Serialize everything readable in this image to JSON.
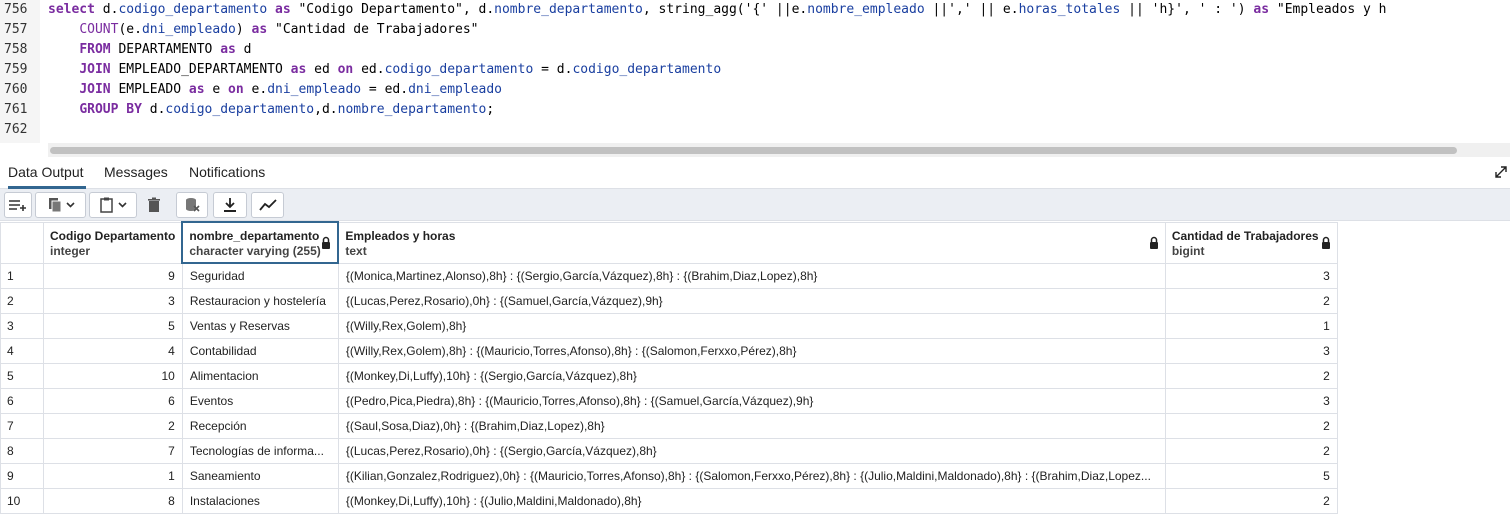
{
  "editor": {
    "lines": [
      {
        "n": "756",
        "segments": [
          {
            "t": "select ",
            "c": "kw"
          },
          {
            "t": "d.",
            "c": "plain"
          },
          {
            "t": "codigo_departamento",
            "c": "id"
          },
          {
            "t": " ",
            "c": "plain"
          },
          {
            "t": "as",
            "c": "kw"
          },
          {
            "t": " \"Codigo Departamento\", d.",
            "c": "plain"
          },
          {
            "t": "nombre_departamento",
            "c": "id"
          },
          {
            "t": ", string_agg('{' ||e.",
            "c": "plain"
          },
          {
            "t": "nombre_empleado",
            "c": "id"
          },
          {
            "t": " ||',' || e.",
            "c": "plain"
          },
          {
            "t": "horas_totales",
            "c": "id"
          },
          {
            "t": " || 'h}', ' : ') ",
            "c": "plain"
          },
          {
            "t": "as",
            "c": "kw"
          },
          {
            "t": " \"Empleados y h",
            "c": "plain"
          }
        ]
      },
      {
        "n": "757",
        "segments": [
          {
            "t": "    ",
            "c": "plain"
          },
          {
            "t": "COUNT",
            "c": "fn"
          },
          {
            "t": "(e.",
            "c": "plain"
          },
          {
            "t": "dni_empleado",
            "c": "id"
          },
          {
            "t": ") ",
            "c": "plain"
          },
          {
            "t": "as",
            "c": "kw"
          },
          {
            "t": " \"Cantidad de Trabajadores\"",
            "c": "plain"
          }
        ]
      },
      {
        "n": "758",
        "segments": [
          {
            "t": "    ",
            "c": "plain"
          },
          {
            "t": "FROM",
            "c": "kw"
          },
          {
            "t": " DEPARTAMENTO ",
            "c": "plain"
          },
          {
            "t": "as",
            "c": "kw"
          },
          {
            "t": " d",
            "c": "plain"
          }
        ]
      },
      {
        "n": "759",
        "segments": [
          {
            "t": "    ",
            "c": "plain"
          },
          {
            "t": "JOIN",
            "c": "kw"
          },
          {
            "t": " EMPLEADO_DEPARTAMENTO ",
            "c": "plain"
          },
          {
            "t": "as",
            "c": "kw"
          },
          {
            "t": " ed ",
            "c": "plain"
          },
          {
            "t": "on",
            "c": "kw"
          },
          {
            "t": " ed.",
            "c": "plain"
          },
          {
            "t": "codigo_departamento",
            "c": "id"
          },
          {
            "t": " = d.",
            "c": "plain"
          },
          {
            "t": "codigo_departamento",
            "c": "id"
          }
        ]
      },
      {
        "n": "760",
        "segments": [
          {
            "t": "    ",
            "c": "plain"
          },
          {
            "t": "JOIN",
            "c": "kw"
          },
          {
            "t": " EMPLEADO ",
            "c": "plain"
          },
          {
            "t": "as",
            "c": "kw"
          },
          {
            "t": " e ",
            "c": "plain"
          },
          {
            "t": "on",
            "c": "kw"
          },
          {
            "t": " e.",
            "c": "plain"
          },
          {
            "t": "dni_empleado",
            "c": "id"
          },
          {
            "t": " = ed.",
            "c": "plain"
          },
          {
            "t": "dni_empleado",
            "c": "id"
          }
        ]
      },
      {
        "n": "761",
        "segments": [
          {
            "t": "    ",
            "c": "plain"
          },
          {
            "t": "GROUP BY",
            "c": "kw"
          },
          {
            "t": " d.",
            "c": "plain"
          },
          {
            "t": "codigo_departamento",
            "c": "id"
          },
          {
            "t": ",d.",
            "c": "plain"
          },
          {
            "t": "nombre_departamento",
            "c": "id"
          },
          {
            "t": ";",
            "c": "plain"
          }
        ]
      },
      {
        "n": "762",
        "segments": []
      }
    ]
  },
  "tabs": {
    "data_output": "Data Output",
    "messages": "Messages",
    "notifications": "Notifications"
  },
  "toolbar": {
    "icons": [
      "add-row-icon",
      "copy-icon",
      "copy-dropdown-icon",
      "paste-icon",
      "paste-dropdown-icon",
      "delete-icon",
      "save-data-icon",
      "download-icon",
      "graph-icon"
    ]
  },
  "columns": [
    {
      "name": "Codigo Departamento",
      "type": "integer",
      "locked": false
    },
    {
      "name": "nombre_departamento",
      "type": "character varying (255)",
      "locked": true
    },
    {
      "name": "Empleados y horas",
      "type": "text",
      "locked": true
    },
    {
      "name": "Cantidad de Trabajadores",
      "type": "bigint",
      "locked": true
    }
  ],
  "rows": [
    {
      "n": "1",
      "codigo": "9",
      "nombre": "Seguridad",
      "empleados": "{(Monica,Martinez,Alonso),8h} : {(Sergio,García,Vázquez),8h} : {(Brahim,Diaz,Lopez),8h}",
      "cantidad": "3"
    },
    {
      "n": "2",
      "codigo": "3",
      "nombre": "Restauracion y hostelería",
      "empleados": "{(Lucas,Perez,Rosario),0h} : {(Samuel,García,Vázquez),9h}",
      "cantidad": "2"
    },
    {
      "n": "3",
      "codigo": "5",
      "nombre": "Ventas y Reservas",
      "empleados": "{(Willy,Rex,Golem),8h}",
      "cantidad": "1"
    },
    {
      "n": "4",
      "codigo": "4",
      "nombre": "Contabilidad",
      "empleados": "{(Willy,Rex,Golem),8h} : {(Mauricio,Torres,Afonso),8h} : {(Salomon,Ferxxo,Pérez),8h}",
      "cantidad": "3"
    },
    {
      "n": "5",
      "codigo": "10",
      "nombre": "Alimentacion",
      "empleados": "{(Monkey,Di,Luffy),10h} : {(Sergio,García,Vázquez),8h}",
      "cantidad": "2"
    },
    {
      "n": "6",
      "codigo": "6",
      "nombre": "Eventos",
      "empleados": "{(Pedro,Pica,Piedra),8h} : {(Mauricio,Torres,Afonso),8h} : {(Samuel,García,Vázquez),9h}",
      "cantidad": "3"
    },
    {
      "n": "7",
      "codigo": "2",
      "nombre": "Recepción",
      "empleados": "{(Saul,Sosa,Diaz),0h} : {(Brahim,Diaz,Lopez),8h}",
      "cantidad": "2"
    },
    {
      "n": "8",
      "codigo": "7",
      "nombre": "Tecnologías de informa...",
      "empleados": "{(Lucas,Perez,Rosario),0h} : {(Sergio,García,Vázquez),8h}",
      "cantidad": "2"
    },
    {
      "n": "9",
      "codigo": "1",
      "nombre": "Saneamiento",
      "empleados": "{(Kilian,Gonzalez,Rodriguez),0h} : {(Mauricio,Torres,Afonso),8h} : {(Salomon,Ferxxo,Pérez),8h} : {(Julio,Maldini,Maldonado),8h} : {(Brahim,Diaz,Lopez...",
      "cantidad": "5"
    },
    {
      "n": "10",
      "codigo": "8",
      "nombre": "Instalaciones",
      "empleados": "{(Monkey,Di,Luffy),10h} : {(Julio,Maldini,Maldonado),8h}",
      "cantidad": "2"
    }
  ]
}
